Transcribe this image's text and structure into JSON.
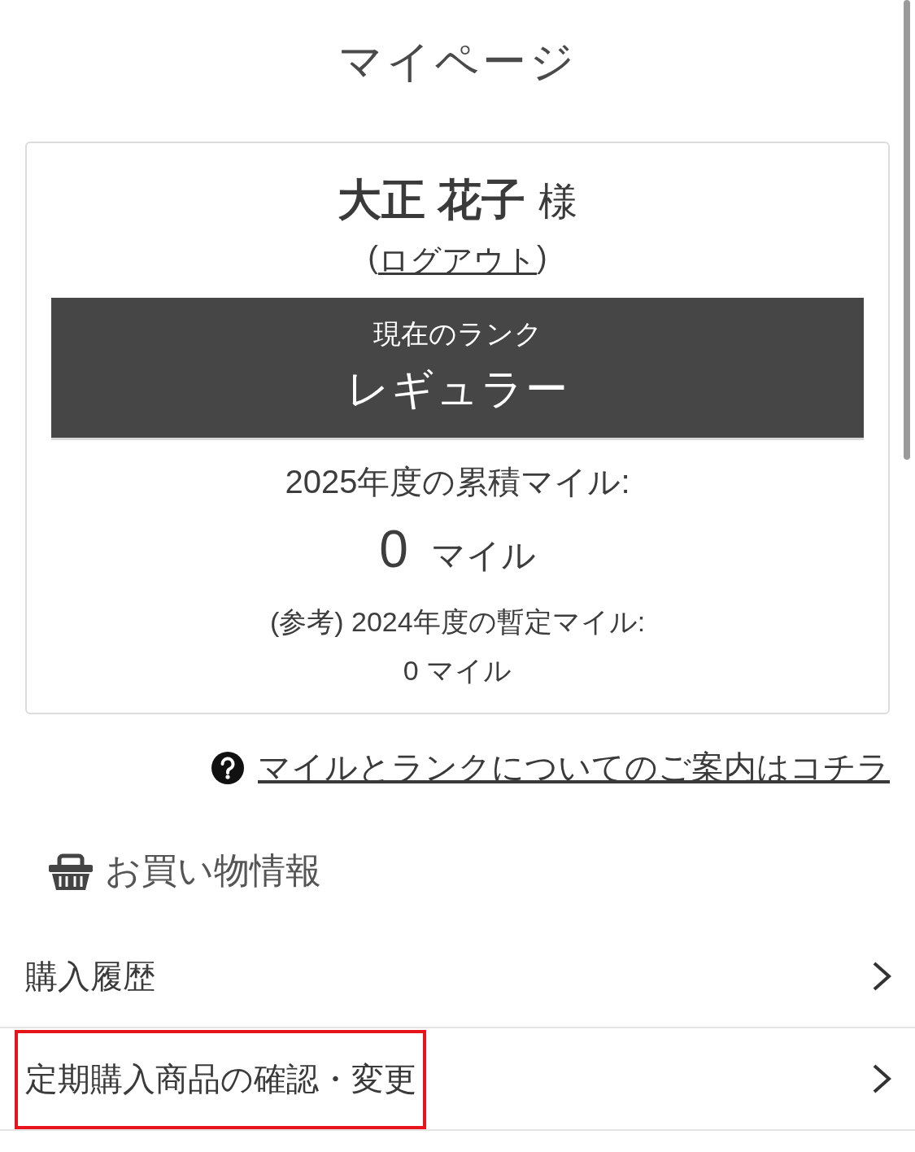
{
  "page_title": "マイページ",
  "profile": {
    "name": "大正 花子",
    "honorific": "様",
    "logout": {
      "open": "(",
      "label": "ログアウト",
      "close": ")"
    },
    "rank": {
      "caption": "現在のランク",
      "value": "レギュラー"
    },
    "miles": {
      "label": "2025年度の累積マイル:",
      "amount": "0",
      "unit": "マイル"
    },
    "reference": {
      "label": "(参考) 2024年度の暫定マイル:",
      "value": "0 マイル"
    }
  },
  "help_link": "マイルとランクについてのご案内はコチラ",
  "section": {
    "title": "お買い物情報",
    "items": [
      {
        "label": "購入履歴",
        "highlighted": false
      },
      {
        "label": "定期購入商品の確認・変更",
        "highlighted": true
      }
    ]
  }
}
